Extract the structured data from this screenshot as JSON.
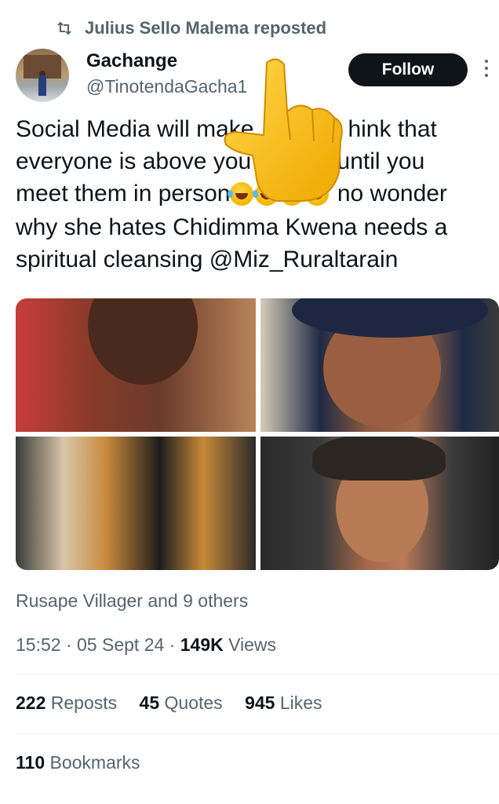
{
  "repost": {
    "text": "Julius Sello Malema reposted",
    "icon": "repost-icon"
  },
  "author": {
    "name": "Gachange",
    "handle": "@TinotendaGacha1",
    "avatar": "avatar"
  },
  "follow_label": "Follow",
  "tweet": {
    "lines": [
      "Social Media will make",
      "hink that",
      "everyone is above you",
      "s until you",
      "meet them in person",
      "no wonder",
      "why she hates Chidimma Kwena needs a",
      "spiritual cleansing @Miz_Ruraltarain"
    ]
  },
  "liked_by": "Rusape Villager and 9 others",
  "meta": {
    "time": "15:52",
    "sep1": " · ",
    "date": "05 Sept 24",
    "sep2": " · ",
    "views": "149K",
    "views_label": " Views"
  },
  "stats": {
    "reposts": "222",
    "reposts_label": "Reposts",
    "quotes": "45",
    "quotes_label": "Quotes",
    "likes": "945",
    "likes_label": "Likes",
    "bookmarks": "110",
    "bookmarks_label": "Bookmarks"
  },
  "colors": {
    "muted": "#536471",
    "text": "#0f1419",
    "follow_bg": "#0f1419",
    "divider": "#eff3f4"
  }
}
